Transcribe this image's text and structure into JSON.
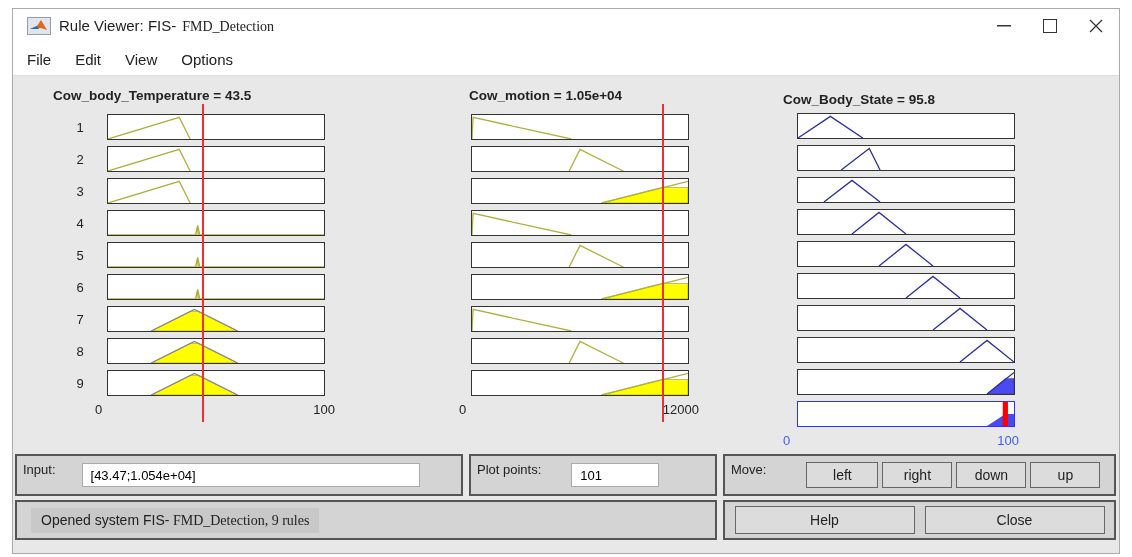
{
  "window": {
    "title_prefix": "Rule Viewer: FIS-",
    "title_name": "FMD_Detection"
  },
  "menu": [
    "File",
    "Edit",
    "View",
    "Options"
  ],
  "rule_numbers": [
    "1",
    "2",
    "3",
    "4",
    "5",
    "6",
    "7",
    "8",
    "9"
  ],
  "inputs": [
    {
      "title": "Cow_body_Temperature = 43.5",
      "xmin": "0",
      "xmax": "100"
    },
    {
      "title": "Cow_motion = 1.05e+04",
      "xmin": "0",
      "xmax": "12000"
    }
  ],
  "output": {
    "title": "Cow_Body_State = 95.8",
    "xmin": "0",
    "xmax": "100"
  },
  "input_panel": {
    "label": "Input:",
    "value": "[43.47;1.054e+04]"
  },
  "plot_points": {
    "label": "Plot points:",
    "value": "101"
  },
  "move": {
    "label": "Move:",
    "buttons": [
      "left",
      "right",
      "down",
      "up"
    ]
  },
  "status": {
    "prefix": "Opened system FIS-",
    "name": "FMD_Detection, 9 rules"
  },
  "buttons": [
    "Help",
    "Close"
  ]
}
